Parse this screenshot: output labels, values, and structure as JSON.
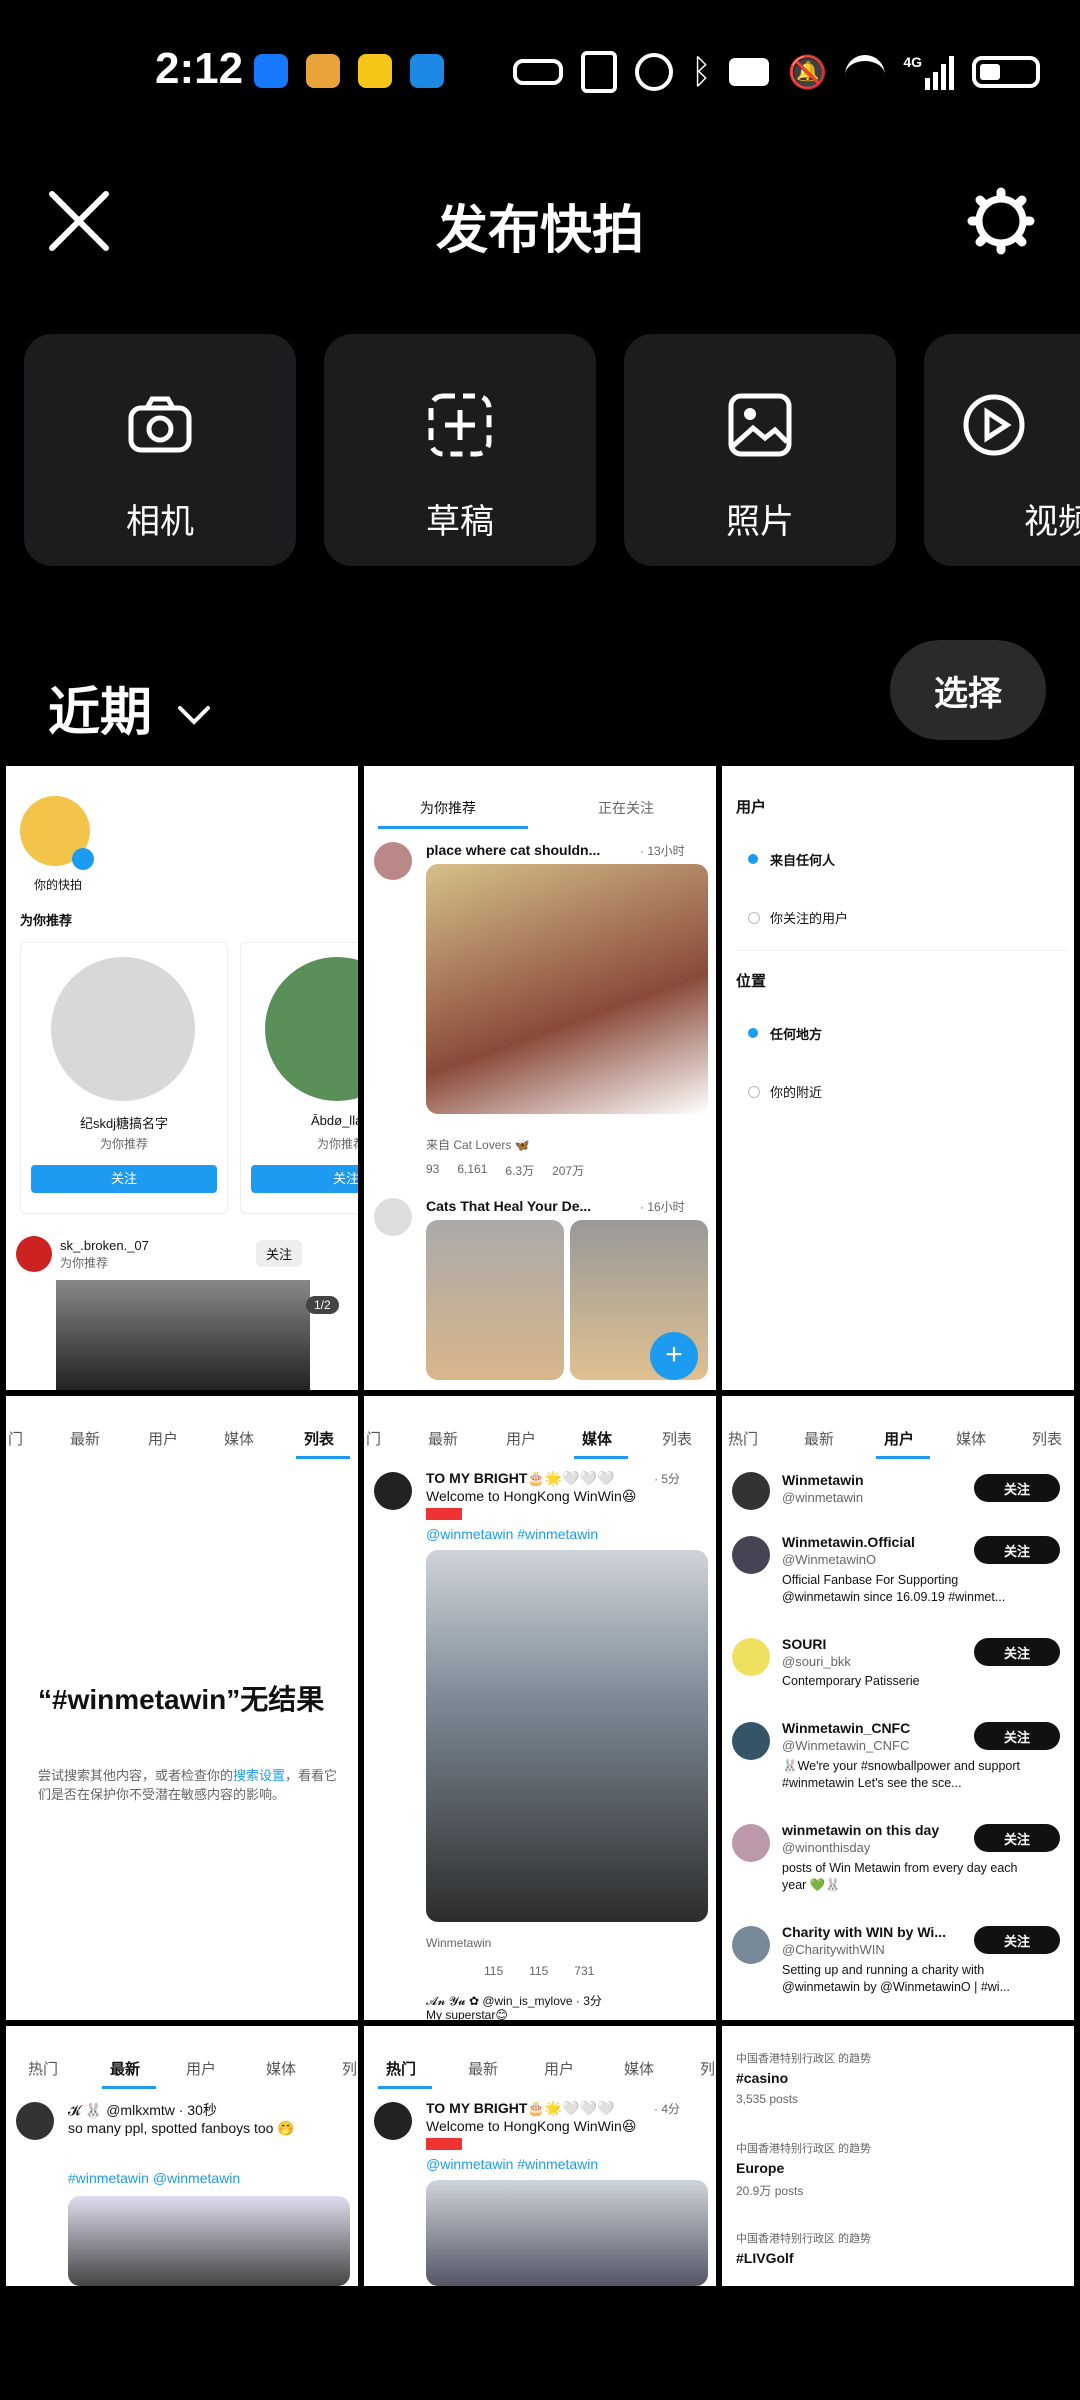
{
  "status_bar": {
    "time": "2:12",
    "app_icons": [
      "alipay-icon",
      "app-icon",
      "mail-icon",
      "shopping-icon"
    ],
    "system_icons": [
      "key-icon",
      "nfc-icon",
      "alarm-icon",
      "bluetooth-icon",
      "camera-icon",
      "mute-icon",
      "wifi-icon",
      "signal-icon",
      "battery-icon"
    ],
    "signal_label": "4G"
  },
  "header": {
    "title": "发布快拍"
  },
  "sources": [
    {
      "label": "相机",
      "icon": "camera-icon"
    },
    {
      "label": "草稿",
      "icon": "draft-icon"
    },
    {
      "label": "照片",
      "icon": "photo-icon"
    },
    {
      "label": "视频",
      "icon": "video-icon"
    }
  ],
  "recent": {
    "label": "近期",
    "select_label": "选择"
  },
  "thumbs": {
    "t1": {
      "story_label": "你的快拍",
      "suggest_title": "为你推荐",
      "card1_name": "纪skdj糖搞名字",
      "card1_sub": "为你推荐",
      "card2_name": "Ābdø_llah",
      "card2_sub": "为你推荐",
      "follow": "关注",
      "post_user": "sk_.broken._07",
      "post_sub": "为你推荐",
      "page": "1/2"
    },
    "t2": {
      "tab1": "为你推荐",
      "tab2": "正在关注",
      "post1_title": "place where cat shouldn...",
      "post1_time": "· 13小时",
      "post1_source": "来自 Cat Lovers 🦋",
      "post1_stats": [
        "93",
        "6,161",
        "6.3万",
        "207万"
      ],
      "post2_title": "Cats That Heal Your De...",
      "post2_time": "· 16小时"
    },
    "t3": {
      "section1": "用户",
      "opt1": "来自任何人",
      "opt2": "你关注的用户",
      "section2": "位置",
      "opt3": "任何地方",
      "opt4": "你的附近"
    },
    "t4": {
      "tabs": [
        "门",
        "最新",
        "用户",
        "媒体",
        "列表"
      ],
      "headline": "“#winmetawin”无结果",
      "body_pre": "尝试搜索其他内容，或者检查你的",
      "body_link": "搜索设置",
      "body_post": "，看看它们是否在保护你不受潜在敏感内容的影响。"
    },
    "t5": {
      "tabs": [
        "门",
        "最新",
        "用户",
        "媒体",
        "列表"
      ],
      "user": "TO MY BRIGHT🎂🌟🤍🤍🤍",
      "time": "· 5分",
      "text": "Welcome to HongKong WinWin😆",
      "tags": "@winmetawin #winmetawin",
      "caption": "Winmetawin",
      "stats": [
        "115",
        "115",
        "731"
      ],
      "next_user": "𝓐𝓷 𝓨𝓾 ✿ @win_is_mylove · 3分",
      "next_text": "My superstar😊"
    },
    "t6": {
      "tabs": [
        "热门",
        "最新",
        "用户",
        "媒体",
        "列表"
      ],
      "follow": "关注",
      "users": [
        {
          "name": "Winmetawin",
          "handle": "@winmetawin",
          "bio": ""
        },
        {
          "name": "Winmetawin.Official",
          "handle": "@WinmetawinO",
          "bio": "Official Fanbase For Supporting @winmetawin since 16.09.19 #winmet..."
        },
        {
          "name": "SOURI",
          "handle": "@souri_bkk",
          "bio": "Contemporary Patisserie"
        },
        {
          "name": "Winmetawin_CNFC",
          "handle": "@Winmetawin_CNFC",
          "bio": "🐰We're your #snowballpower and support #winmetawin Let's see the sce..."
        },
        {
          "name": "winmetawin on this day",
          "handle": "@winonthisday",
          "bio": "posts of Win Metawin from every day each year 💚🐰"
        },
        {
          "name": "Charity with WIN by Wi...",
          "handle": "@CharitywithWIN",
          "bio": "Setting up and running a charity with @winmetawin by @WinmetawinO | #wi..."
        }
      ]
    },
    "t7": {
      "tabs": [
        "热门",
        "最新",
        "用户",
        "媒体",
        "列"
      ],
      "user": "𝓚 🐰 @mlkxmtw · 30秒",
      "text": "so many ppl, spotted fanboys too 🤭",
      "tags": "#winmetawin @winmetawin"
    },
    "t8": {
      "tabs": [
        "热门",
        "最新",
        "用户",
        "媒体",
        "列"
      ],
      "user": "TO MY BRIGHT🎂🌟🤍🤍🤍",
      "time": "· 4分",
      "text": "Welcome to HongKong WinWin😆",
      "tags": "@winmetawin #winmetawin"
    },
    "t9": {
      "trends": [
        {
          "region": "中国香港特别行政区 的趋势",
          "tag": "#casino",
          "count": "3,535 posts"
        },
        {
          "region": "中国香港特别行政区 的趋势",
          "tag": "Europe",
          "count": "20.9万 posts"
        },
        {
          "region": "中国香港特别行政区 的趋势",
          "tag": "#LIVGolf",
          "count": ""
        }
      ]
    }
  }
}
